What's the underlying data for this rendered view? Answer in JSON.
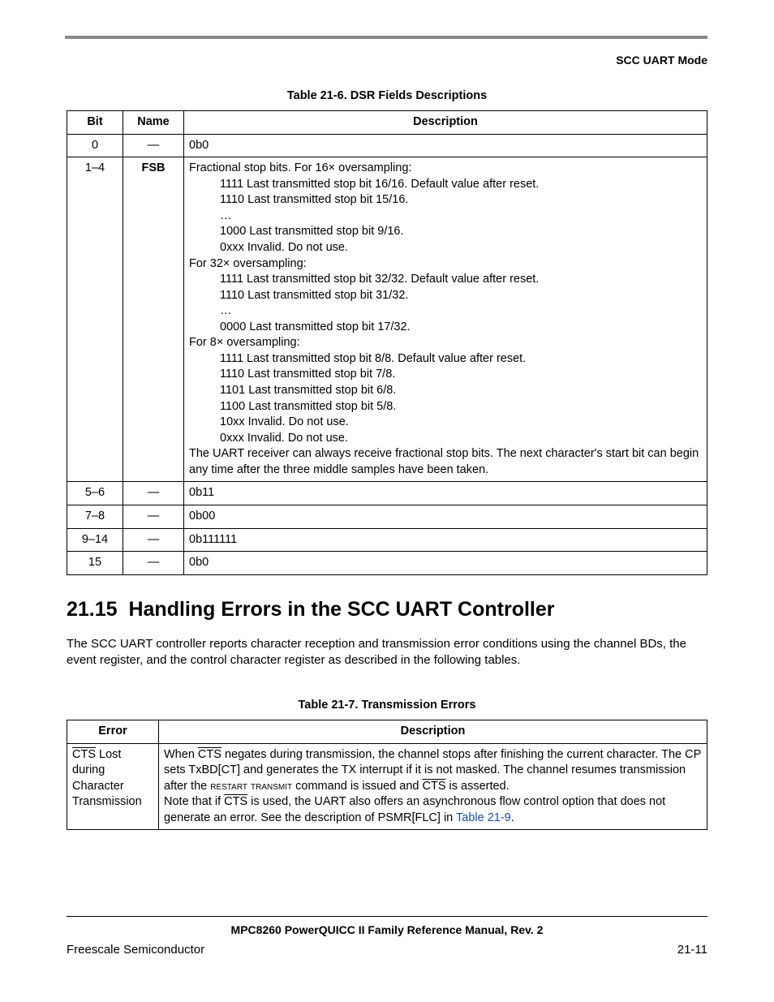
{
  "header": {
    "mode": "SCC UART Mode"
  },
  "table1": {
    "caption": "Table 21-6. DSR Fields Descriptions",
    "headers": {
      "bit": "Bit",
      "name": "Name",
      "desc": "Description"
    },
    "rows": [
      {
        "bit": "0",
        "name": "—",
        "desc_plain": "0b0"
      },
      {
        "bit": "1–4",
        "name": "FSB",
        "fsb": {
          "l0": "Fractional stop bits. For 16× oversampling:",
          "l1": "1111 Last transmitted stop bit 16/16. Default value after reset.",
          "l2": "1110 Last transmitted stop bit 15/16.",
          "l3": "…",
          "l4": "1000 Last transmitted stop bit 9/16.",
          "l5": "0xxx Invalid. Do not use.",
          "l6": "For 32× oversampling:",
          "l7": "1111 Last transmitted stop bit 32/32. Default value after reset.",
          "l8": "1110 Last transmitted stop bit 31/32.",
          "l9": "…",
          "l10": "0000 Last transmitted stop bit 17/32.",
          "l11": "For 8× oversampling:",
          "l12": "1111 Last transmitted stop bit 8/8. Default value after reset.",
          "l13": "1110 Last transmitted stop bit 7/8.",
          "l14": "1101 Last transmitted stop bit 6/8.",
          "l15": "1100 Last transmitted stop bit 5/8.",
          "l16": "10xx  Invalid. Do not use.",
          "l17": "0xxx  Invalid. Do not use.",
          "l18": "The UART receiver can always receive fractional stop bits. The next character's start bit can begin any time after the three middle samples have been taken."
        }
      },
      {
        "bit": "5–6",
        "name": "—",
        "desc_plain": "0b11"
      },
      {
        "bit": "7–8",
        "name": "—",
        "desc_plain": "0b00"
      },
      {
        "bit": "9–14",
        "name": "—",
        "desc_plain": "0b111111"
      },
      {
        "bit": "15",
        "name": "—",
        "desc_plain": "0b0"
      }
    ]
  },
  "section": {
    "num": "21.15",
    "title": "Handling Errors in the SCC UART Controller",
    "para": "The SCC UART controller reports character reception and transmission error conditions using the channel BDs, the event register, and the control character register as described in the following tables."
  },
  "table2": {
    "caption": "Table 21-7. Transmission Errors",
    "headers": {
      "err": "Error",
      "desc": "Description"
    },
    "row0": {
      "err_pre": " Lost during Character Transmission",
      "d1a": "When ",
      "d1b": " negates during transmission, the channel stops after finishing the current character. The CP sets TxBD[CT] and generates the TX interrupt if it is not masked. The channel resumes transmission after the ",
      "d1c": "restart transmit",
      "d1d": " command is issued and ",
      "d1e": " is asserted.",
      "d2a": "Note that if ",
      "d2b": " is used, the UART also offers an asynchronous flow control option that does not generate an error. See the description of PSMR[FLC] in ",
      "d2c": "Table 21-9",
      "d2d": ".",
      "cts": "CTS"
    }
  },
  "footer": {
    "title": "MPC8260 PowerQUICC II Family Reference Manual, Rev. 2",
    "left": "Freescale Semiconductor",
    "right": "21-11"
  }
}
